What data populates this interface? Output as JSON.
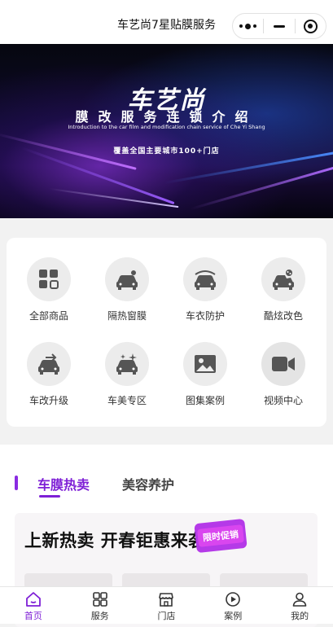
{
  "header": {
    "title": "车艺尚7星贴膜服务"
  },
  "banner": {
    "brand": "车艺尚",
    "title": "膜改服务连锁介绍",
    "subtitle": "Introduction to the car film and modification chain service of Che Yi Shang",
    "tag": "覆盖全国主要城市100+门店"
  },
  "grid": {
    "items": [
      {
        "label": "全部商品",
        "icon": "all-products-icon"
      },
      {
        "label": "隔热窗膜",
        "icon": "heat-insulation-film-icon"
      },
      {
        "label": "车衣防护",
        "icon": "car-cover-icon"
      },
      {
        "label": "酷炫改色",
        "icon": "color-change-icon"
      },
      {
        "label": "车改升级",
        "icon": "car-upgrade-icon"
      },
      {
        "label": "车美专区",
        "icon": "car-beauty-icon"
      },
      {
        "label": "图集案例",
        "icon": "gallery-icon"
      },
      {
        "label": "视频中心",
        "icon": "video-icon"
      }
    ]
  },
  "tabs": {
    "active": "车膜热卖",
    "inactive": "美容养护"
  },
  "promo": {
    "title": "上新热卖 开春钜惠来袭",
    "badge": "限时促销"
  },
  "tabbar": {
    "items": [
      {
        "label": "首页",
        "icon": "home-icon"
      },
      {
        "label": "服务",
        "icon": "services-icon"
      },
      {
        "label": "门店",
        "icon": "store-icon"
      },
      {
        "label": "案例",
        "icon": "play-icon"
      },
      {
        "label": "我的",
        "icon": "profile-icon"
      }
    ]
  },
  "colors": {
    "accent": "#7e1fd6"
  }
}
